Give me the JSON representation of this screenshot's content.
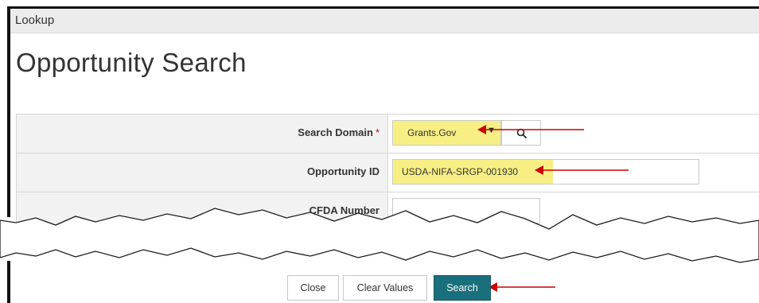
{
  "window": {
    "title": "Lookup"
  },
  "page": {
    "title": "Opportunity Search"
  },
  "form": {
    "search_domain": {
      "label": "Search Domain",
      "required_mark": "*",
      "value": "Grants.Gov",
      "arrow_icon": "triangle-down"
    },
    "opportunity_id": {
      "label": "Opportunity ID",
      "value": "USDA-NIFA-SRGP-001930"
    },
    "cfda_number": {
      "label": "CFDA Number",
      "value": ""
    }
  },
  "buttons": {
    "close": "Close",
    "clear": "Clear Values",
    "search": "Search"
  },
  "colors": {
    "highlight": "#f8ef84",
    "search_button": "#1a6f7c",
    "arrow": "#cc0000"
  }
}
